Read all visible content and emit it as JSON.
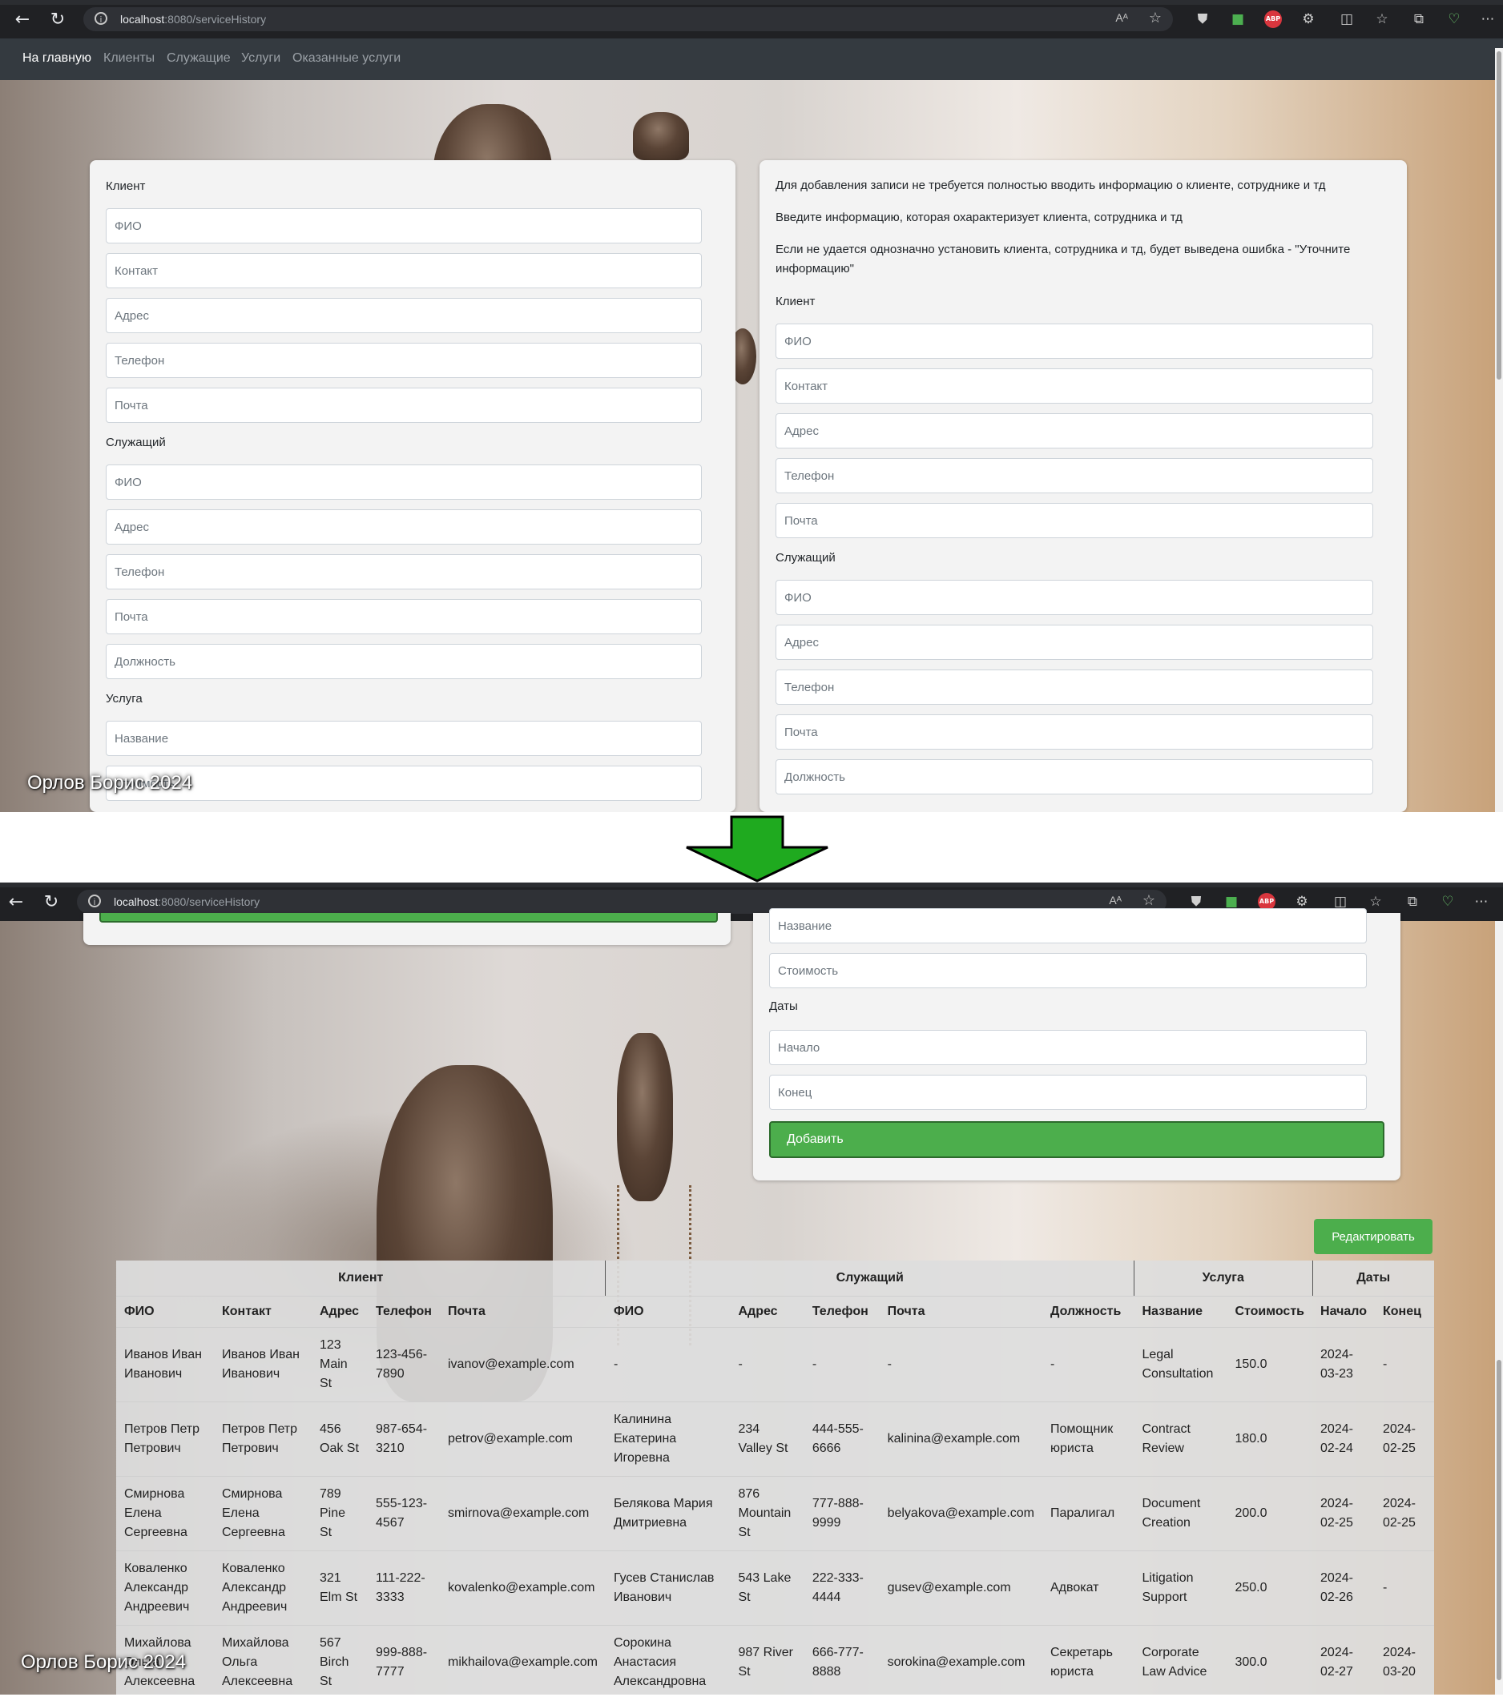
{
  "browser": {
    "url_host": "localhost",
    "url_path": ":8080/serviceHistory",
    "reader_label": "Aᴬ"
  },
  "navbar": {
    "items": [
      "На главную",
      "Клиенты",
      "Служащие",
      "Услуги",
      "Оказанные услуги"
    ]
  },
  "footer": {
    "text": "Орлов Борис 2024"
  },
  "add_form": {
    "sections": {
      "client": "Клиент",
      "employee": "Служащий",
      "service": "Услуга",
      "dates": "Даты"
    },
    "client_fields": [
      "ФИО",
      "Контакт",
      "Адрес",
      "Телефон",
      "Почта"
    ],
    "employee_fields": [
      "ФИО",
      "Адрес",
      "Телефон",
      "Почта",
      "Должность"
    ],
    "service_fields": [
      "Название",
      "Стоимость"
    ],
    "date_fields": [
      "Начало",
      "Конец"
    ],
    "submit_label": "Добавить"
  },
  "notes": [
    "Для добавления записи не требуется полностью вводить информацию о клиенте, сотруднике и тд",
    "Введите информацию, которая охарактеризует клиента, сотрудника и тд",
    "Если не удается однозначно установить клиента, сотрудника и тд, будет выведена ошибка - \"Уточните информацию\""
  ],
  "edit_button": "Редактировать",
  "table": {
    "groups": [
      "Клиент",
      "Служащий",
      "Услуга",
      "Даты"
    ],
    "columns": [
      "ФИО",
      "Контакт",
      "Адрес",
      "Телефон",
      "Почта",
      "ФИО",
      "Адрес",
      "Телефон",
      "Почта",
      "Должность",
      "Название",
      "Стоимость",
      "Начало",
      "Конец"
    ],
    "rows": [
      [
        "Иванов Иван Иванович",
        "Иванов Иван Иванович",
        "123 Main St",
        "123-456-7890",
        "ivanov@example.com",
        "-",
        "-",
        "-",
        "-",
        "-",
        "Legal Consultation",
        "150.0",
        "2024-03-23",
        "-"
      ],
      [
        "Петров Петр Петрович",
        "Петров Петр Петрович",
        "456 Oak St",
        "987-654-3210",
        "petrov@example.com",
        "Калинина Екатерина Игоревна",
        "234 Valley St",
        "444-555-6666",
        "kalinina@example.com",
        "Помощник юриста",
        "Contract Review",
        "180.0",
        "2024-02-24",
        "2024-02-25"
      ],
      [
        "Смирнова Елена Сергеевна",
        "Смирнова Елена Сергеевна",
        "789 Pine St",
        "555-123-4567",
        "smirnova@example.com",
        "Белякова Мария Дмитриевна",
        "876 Mountain St",
        "777-888-9999",
        "belyakova@example.com",
        "Паралигал",
        "Document Creation",
        "200.0",
        "2024-02-25",
        "2024-02-25"
      ],
      [
        "Коваленко Александр Андреевич",
        "Коваленко Александр Андреевич",
        "321 Elm St",
        "111-222-3333",
        "kovalenko@example.com",
        "Гусев Станислав Иванович",
        "543 Lake St",
        "222-333-4444",
        "gusev@example.com",
        "Адвокат",
        "Litigation Support",
        "250.0",
        "2024-02-26",
        "-"
      ],
      [
        "Михайлова Ольга Алексеевна",
        "Михайлова Ольга Алексеевна",
        "567 Birch St",
        "999-888-7777",
        "mikhailova@example.com",
        "Сорокина Анастасия Александровна",
        "987 River St",
        "666-777-8888",
        "sorokina@example.com",
        "Секретарь юриста",
        "Corporate Law Advice",
        "300.0",
        "2024-02-27",
        "2024-03-20"
      ]
    ]
  },
  "icons": [
    "back-icon",
    "reload-icon",
    "info-icon",
    "favorite-star-icon",
    "shield-icon",
    "extension-icon",
    "adblock-icon",
    "puzzle-icon",
    "split-icon",
    "favorites-icon",
    "collections-icon",
    "health-icon",
    "more-icon",
    "down-arrow-icon"
  ],
  "colors": {
    "navbar": "#343a40",
    "button_green": "#4cae4c",
    "arrow_green": "#1faa1f",
    "card": "#f3f3f3"
  }
}
